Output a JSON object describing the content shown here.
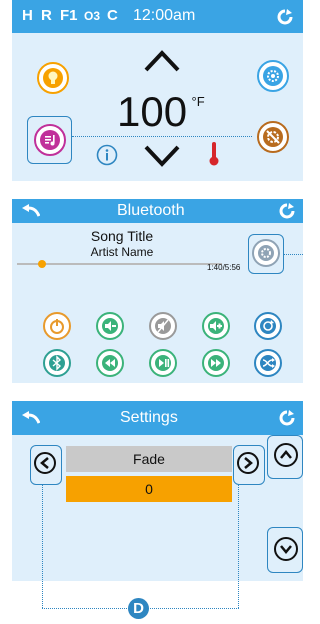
{
  "panel1": {
    "indicators": [
      "H",
      "R",
      "F1",
      "O3",
      "C"
    ],
    "time": "12:00am",
    "temperature": "100",
    "unit": "°F"
  },
  "panel2": {
    "title": "Bluetooth",
    "song_title": "Song Title",
    "artist": "Artist Name",
    "track_time": "1:40/5:56",
    "progress": 0.12
  },
  "panel3": {
    "title": "Settings",
    "setting_name": "Fade",
    "setting_value": "0"
  },
  "callout": "D",
  "colors": {
    "header": "#3aa4e4",
    "panel": "#dfeffb",
    "accent_orange": "#f7a100",
    "highlight": "#2e86c1"
  }
}
